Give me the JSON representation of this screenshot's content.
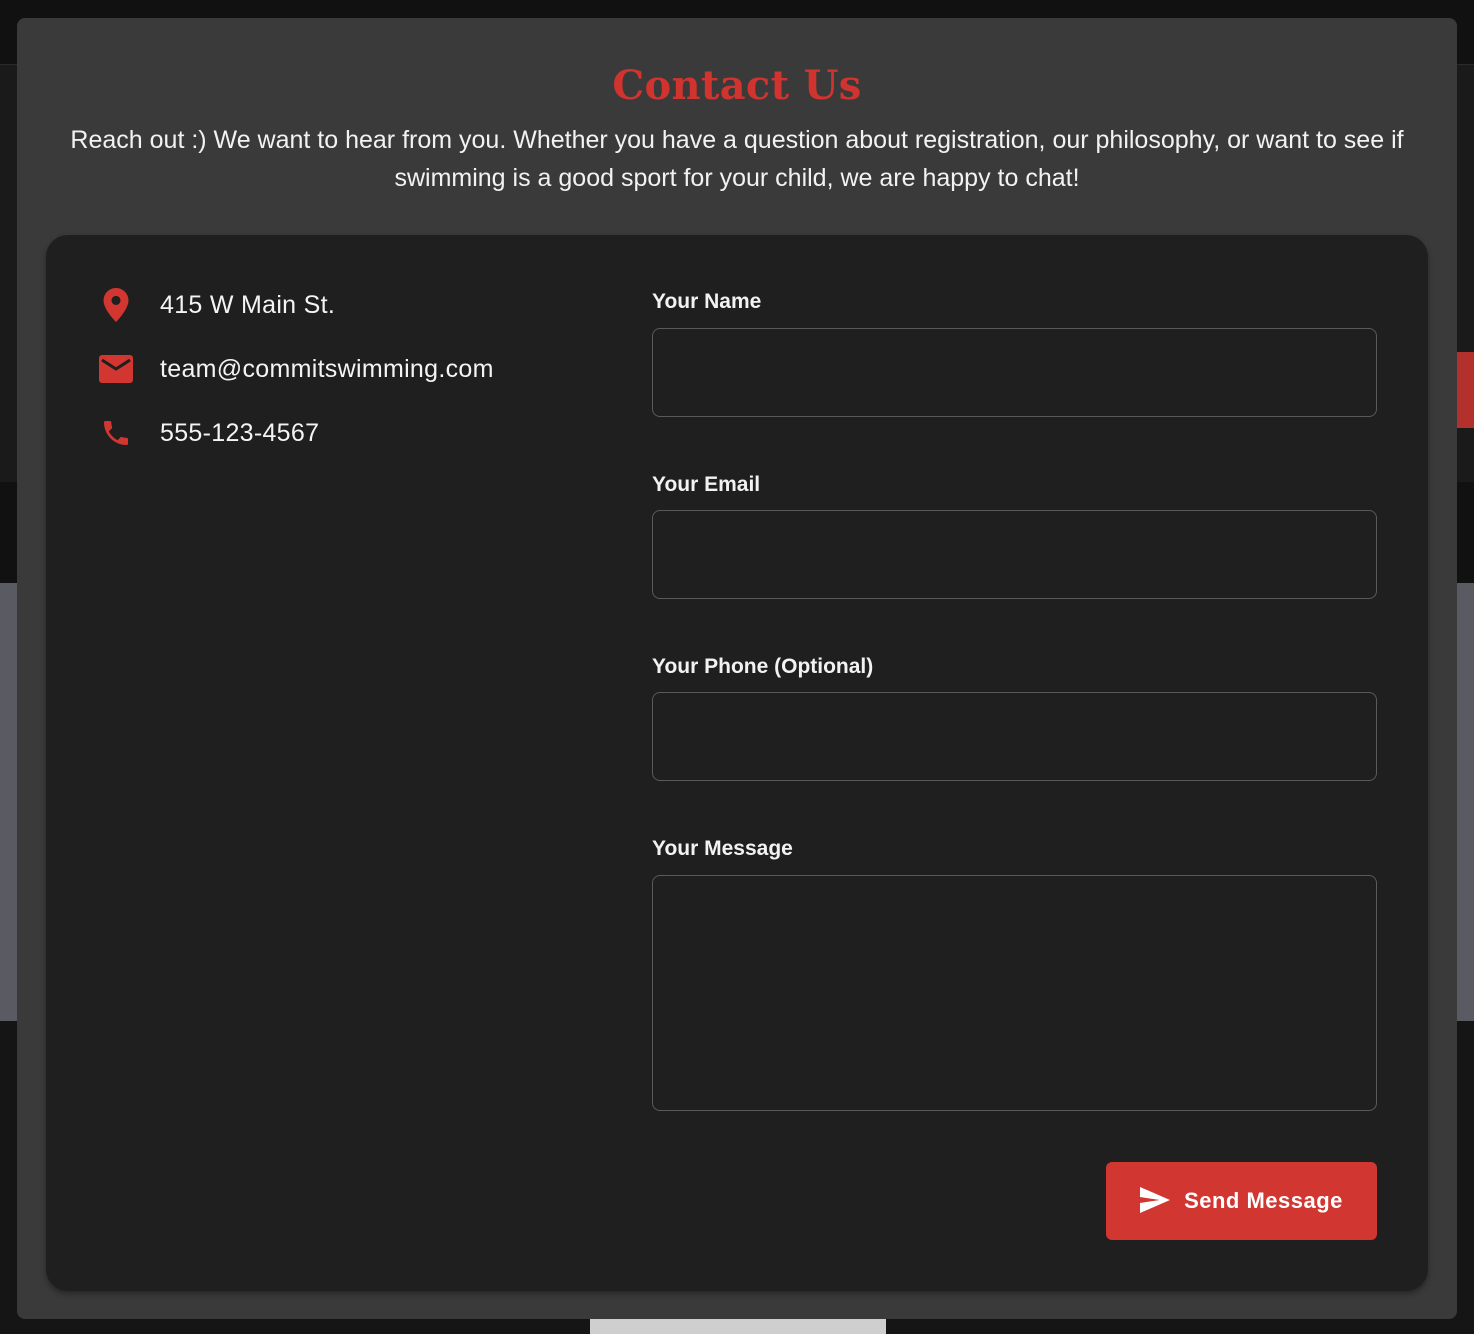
{
  "modal": {
    "title": "Contact Us",
    "intro": "Reach out :) We want to hear from you. Whether you have a question about registration, our philosophy, or want to see if swimming is a good sport for your child, we are happy to chat!"
  },
  "contact_info": {
    "address": {
      "icon": "map-pin-icon",
      "text": "415 W Main St."
    },
    "email": {
      "icon": "mail-icon",
      "text": "team@commitswimming.com"
    },
    "phone": {
      "icon": "phone-icon",
      "text": "555-123-4567"
    }
  },
  "form": {
    "name_label": "Your Name",
    "name_value": "",
    "email_label": "Your Email",
    "email_value": "",
    "phone_label": "Your Phone (Optional)",
    "phone_value": "",
    "message_label": "Your Message",
    "message_value": "",
    "submit_icon": "send-icon",
    "submit_label": "Send Message"
  },
  "colors": {
    "accent": "#d13631",
    "modal_bg": "#3a3a3a",
    "panel_bg": "#1f1f1f"
  }
}
